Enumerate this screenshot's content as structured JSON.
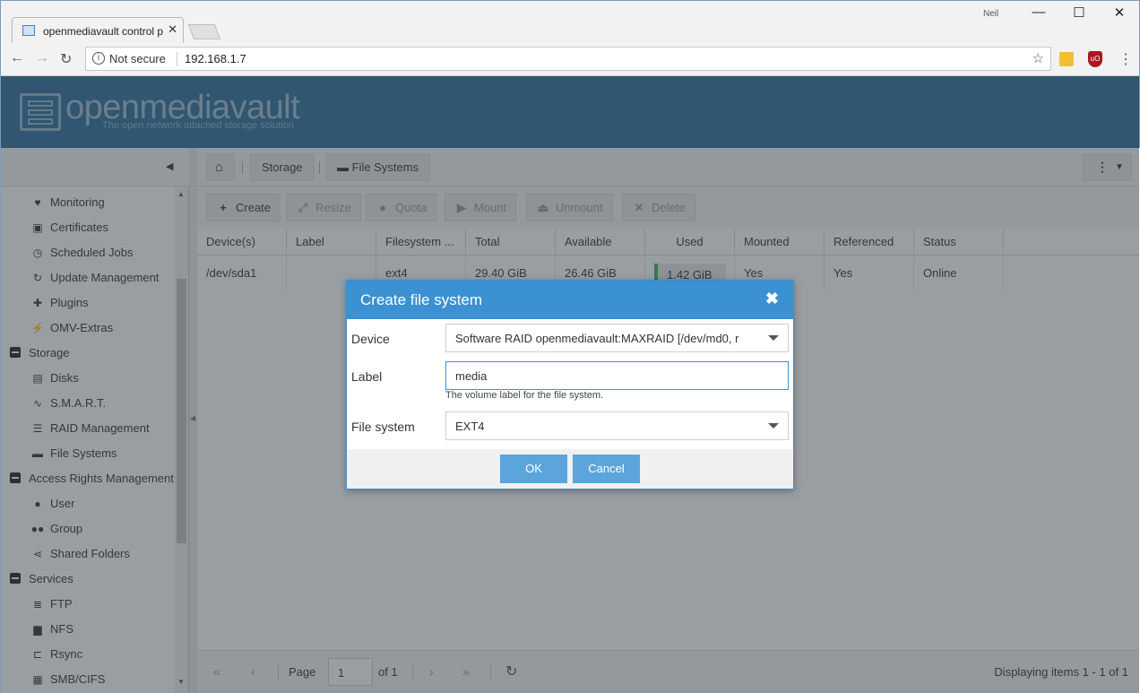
{
  "browser": {
    "tab_title": "openmediavault control p",
    "user": "Neil",
    "security": "Not secure",
    "url": "192.168.1.7",
    "ext_ublock": "uO"
  },
  "header": {
    "brand": "openmediavault",
    "tagline": "The open network attached storage solution"
  },
  "sidebar": {
    "items": [
      {
        "label": "Monitoring",
        "icon": "heartbeat-icon",
        "glyph": "♥",
        "level": 2
      },
      {
        "label": "Certificates",
        "icon": "certificate-icon",
        "glyph": "▣",
        "level": 2
      },
      {
        "label": "Scheduled Jobs",
        "icon": "clock-icon",
        "glyph": "◷",
        "level": 2
      },
      {
        "label": "Update Management",
        "icon": "refresh-icon",
        "glyph": "↻",
        "level": 2
      },
      {
        "label": "Plugins",
        "icon": "puzzle-icon",
        "glyph": "✚",
        "level": 2
      },
      {
        "label": "OMV-Extras",
        "icon": "plug-icon",
        "glyph": "⚡",
        "level": 2
      },
      {
        "label": "Storage",
        "icon": "collapse-icon",
        "glyph": "",
        "level": 1
      },
      {
        "label": "Disks",
        "icon": "disk-icon",
        "glyph": "▤",
        "level": 2
      },
      {
        "label": "S.M.A.R.T.",
        "icon": "pulse-icon",
        "glyph": "∿",
        "level": 2
      },
      {
        "label": "RAID Management",
        "icon": "database-icon",
        "glyph": "☰",
        "level": 2
      },
      {
        "label": "File Systems",
        "icon": "folder-icon",
        "glyph": "▬",
        "level": 2
      },
      {
        "label": "Access Rights Management",
        "icon": "collapse-icon",
        "glyph": "",
        "level": 1
      },
      {
        "label": "User",
        "icon": "user-icon",
        "glyph": "●",
        "level": 2
      },
      {
        "label": "Group",
        "icon": "group-icon",
        "glyph": "●●",
        "level": 2
      },
      {
        "label": "Shared Folders",
        "icon": "share-icon",
        "glyph": "⋖",
        "level": 2
      },
      {
        "label": "Services",
        "icon": "collapse-icon",
        "glyph": "",
        "level": 1
      },
      {
        "label": "FTP",
        "icon": "server-icon",
        "glyph": "≣",
        "level": 2
      },
      {
        "label": "NFS",
        "icon": "desktop-icon",
        "glyph": "▆",
        "level": 2
      },
      {
        "label": "Rsync",
        "icon": "sitemap-icon",
        "glyph": "⊏",
        "level": 2
      },
      {
        "label": "SMB/CIFS",
        "icon": "windows-icon",
        "glyph": "▦",
        "level": 2
      }
    ]
  },
  "breadcrumb": {
    "storage": "Storage",
    "filesystems": "File Systems"
  },
  "toolbar": {
    "create": "Create",
    "resize": "Resize",
    "quota": "Quota",
    "mount": "Mount",
    "unmount": "Unmount",
    "delete": "Delete"
  },
  "grid": {
    "columns": [
      "Device(s)",
      "Label",
      "Filesystem ...",
      "Total",
      "Available",
      "Used",
      "Mounted",
      "Referenced",
      "Status"
    ],
    "rows": [
      {
        "device": "/dev/sda1",
        "label": "",
        "fs": "ext4",
        "total": "29.40 GiB",
        "available": "26.46 GiB",
        "used": "1.42 GiB",
        "mounted": "Yes",
        "referenced": "Yes",
        "status": "Online"
      }
    ]
  },
  "pager": {
    "page_label": "Page",
    "page": "1",
    "of": "of 1",
    "displaying": "Displaying items 1 - 1 of 1"
  },
  "dialog": {
    "title": "Create file system",
    "device_label": "Device",
    "device_value": "Software RAID openmediavault:MAXRAID [/dev/md0, r",
    "label_label": "Label",
    "label_value": "media",
    "label_hint": "The volume label for the file system.",
    "fs_label": "File system",
    "fs_value": "EXT4",
    "ok": "OK",
    "cancel": "Cancel"
  },
  "colors": {
    "header_bg": "#2d6f9a",
    "dialog_accent": "#3b91d1",
    "button": "#5ba5dc",
    "used_bar": "#3cb24a"
  }
}
